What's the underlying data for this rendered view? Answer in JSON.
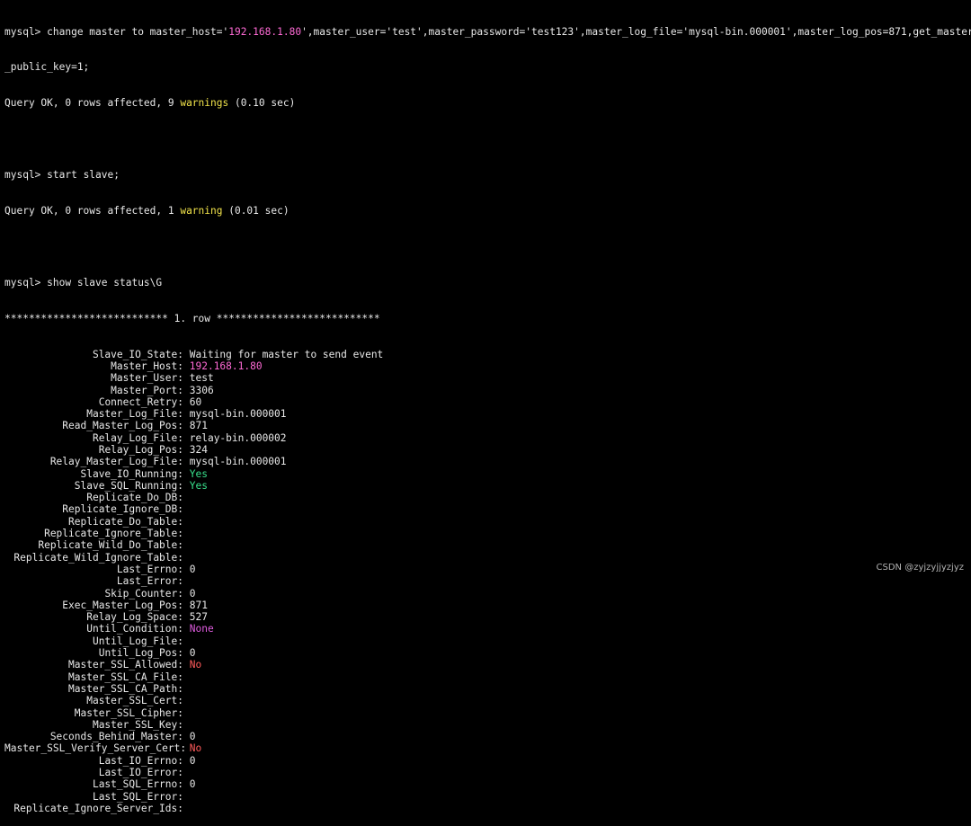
{
  "terminal": {
    "cmd1": {
      "prompt": "mysql> ",
      "text_a": "change master to master_host='",
      "host": "192.168.1.80",
      "text_b": "',master_user='test',master_password='test123',master_log_file='mysql-bin.000001',master_log_pos=871,get_master",
      "text_c": "_public_key=1;",
      "result_a": "Query OK, 0 rows affected, 9 ",
      "result_warn": "warnings",
      "result_b": " (0.10 sec)"
    },
    "cmd2": {
      "prompt": "mysql> ",
      "text": "start slave;",
      "result_a": "Query OK, 0 rows affected, 1 ",
      "result_warn": "warning",
      "result_b": " (0.01 sec)"
    },
    "cmd3": {
      "prompt": "mysql> ",
      "text": "show slave status\\G",
      "row_header": "*************************** 1. row ***************************"
    },
    "fields": [
      {
        "label": "Slave_IO_State:",
        "value": "Waiting for master to send event",
        "style": ""
      },
      {
        "label": "Master_Host:",
        "value": "192.168.1.80",
        "style": "c-host"
      },
      {
        "label": "Master_User:",
        "value": "test",
        "style": ""
      },
      {
        "label": "Master_Port:",
        "value": "3306",
        "style": ""
      },
      {
        "label": "Connect_Retry:",
        "value": "60",
        "style": ""
      },
      {
        "label": "Master_Log_File:",
        "value": "mysql-bin.000001",
        "style": ""
      },
      {
        "label": "Read_Master_Log_Pos:",
        "value": "871",
        "style": ""
      },
      {
        "label": "Relay_Log_File:",
        "value": "relay-bin.000002",
        "style": ""
      },
      {
        "label": "Relay_Log_Pos:",
        "value": "324",
        "style": ""
      },
      {
        "label": "Relay_Master_Log_File:",
        "value": "mysql-bin.000001",
        "style": ""
      },
      {
        "label": "Slave_IO_Running:",
        "value": "Yes",
        "style": "c-yes"
      },
      {
        "label": "Slave_SQL_Running:",
        "value": "Yes",
        "style": "c-yes"
      },
      {
        "label": "Replicate_Do_DB:",
        "value": "",
        "style": ""
      },
      {
        "label": "Replicate_Ignore_DB:",
        "value": "",
        "style": ""
      },
      {
        "label": "Replicate_Do_Table:",
        "value": "",
        "style": ""
      },
      {
        "label": "Replicate_Ignore_Table:",
        "value": "",
        "style": ""
      },
      {
        "label": "Replicate_Wild_Do_Table:",
        "value": "",
        "style": ""
      },
      {
        "label": "Replicate_Wild_Ignore_Table:",
        "value": "",
        "style": ""
      },
      {
        "label": "Last_Errno:",
        "value": "0",
        "style": ""
      },
      {
        "label": "Last_Error:",
        "value": "",
        "style": ""
      },
      {
        "label": "Skip_Counter:",
        "value": "0",
        "style": ""
      },
      {
        "label": "Exec_Master_Log_Pos:",
        "value": "871",
        "style": ""
      },
      {
        "label": "Relay_Log_Space:",
        "value": "527",
        "style": ""
      },
      {
        "label": "Until_Condition:",
        "value": "None",
        "style": "c-none"
      },
      {
        "label": "Until_Log_File:",
        "value": "",
        "style": ""
      },
      {
        "label": "Until_Log_Pos:",
        "value": "0",
        "style": ""
      },
      {
        "label": "Master_SSL_Allowed:",
        "value": "No",
        "style": "c-no"
      },
      {
        "label": "Master_SSL_CA_File:",
        "value": "",
        "style": ""
      },
      {
        "label": "Master_SSL_CA_Path:",
        "value": "",
        "style": ""
      },
      {
        "label": "Master_SSL_Cert:",
        "value": "",
        "style": ""
      },
      {
        "label": "Master_SSL_Cipher:",
        "value": "",
        "style": ""
      },
      {
        "label": "Master_SSL_Key:",
        "value": "",
        "style": ""
      },
      {
        "label": "Seconds_Behind_Master:",
        "value": "0",
        "style": ""
      },
      {
        "label": "Master_SSL_Verify_Server_Cert:",
        "value": "No",
        "style": "c-no"
      },
      {
        "label": "Last_IO_Errno:",
        "value": "0",
        "style": ""
      },
      {
        "label": "Last_IO_Error:",
        "value": "",
        "style": ""
      },
      {
        "label": "Last_SQL_Errno:",
        "value": "0",
        "style": ""
      },
      {
        "label": "Last_SQL_Error:",
        "value": "",
        "style": ""
      },
      {
        "label": "Replicate_Ignore_Server_Ids:",
        "value": "",
        "style": ""
      }
    ]
  },
  "watermark": "CSDN @zyjzyjjyzjyz",
  "colors": {
    "background": "#000000",
    "text": "#e8e8e8",
    "string": "#ff6ad5",
    "warning": "#f0e24a",
    "yes": "#38e08c",
    "no": "#ff5a5a",
    "none": "#e05ce0"
  }
}
